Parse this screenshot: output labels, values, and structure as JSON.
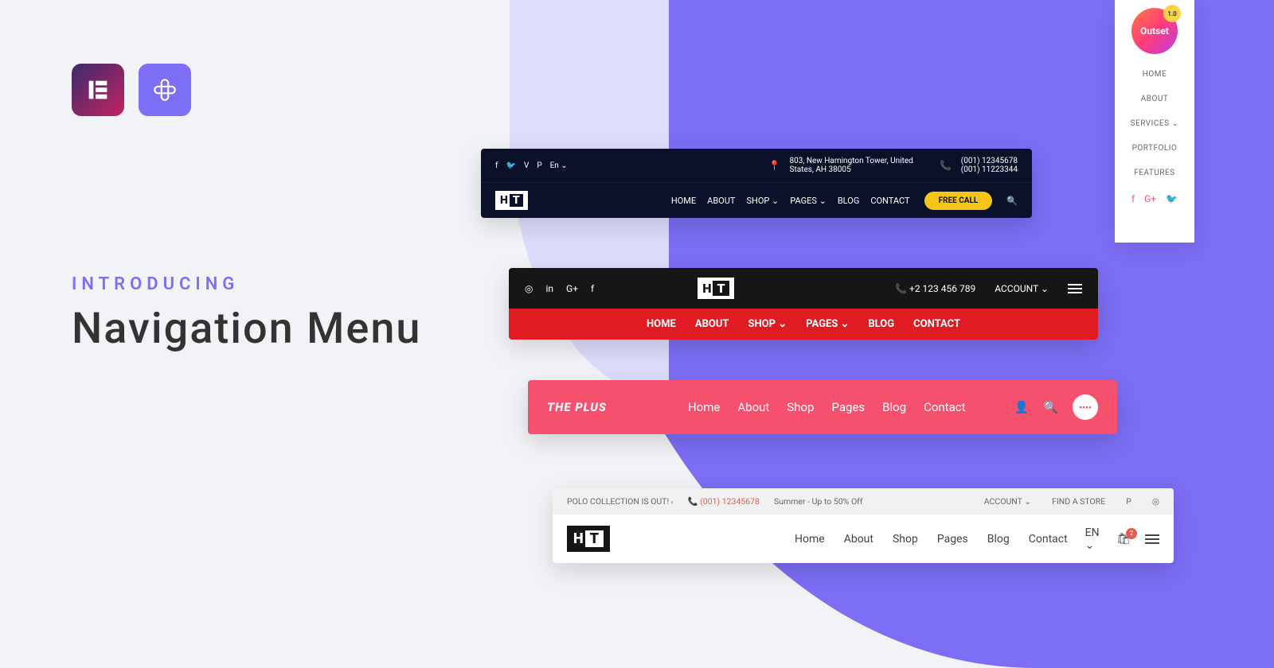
{
  "colors": {
    "purple": "#7c6ef5",
    "pink": "#f5506e",
    "red": "#e11b23",
    "yellow": "#f5c518",
    "dark": "#0b1128"
  },
  "headline": {
    "eyebrow": "INTRODUCING",
    "title": "Navigation Menu"
  },
  "outset": {
    "logo": "Outset",
    "badge": "1.0",
    "items": [
      "HOME",
      "ABOUT",
      "SERVICES ⌄",
      "PORTFOLIO",
      "FEATURES"
    ]
  },
  "nav1": {
    "lang": "En ⌄",
    "address_l1": "803, New Hamington Tower, United",
    "address_l2": "States, AH 38005",
    "phone1": "(001) 12345678",
    "phone2": "(001) 11223344",
    "menu": [
      "HOME",
      "ABOUT",
      "SHOP ⌄",
      "PAGES ⌄",
      "BLOG",
      "CONTACT"
    ],
    "cta": "FREE CALL"
  },
  "nav2": {
    "phone": "+2 123 456 789",
    "account": "ACCOUNT ⌄",
    "menu": [
      "HOME",
      "ABOUT",
      "SHOP ⌄",
      "PAGES ⌄",
      "BLOG",
      "CONTACT"
    ]
  },
  "nav3": {
    "brand": "THE PLUS",
    "menu": [
      "Home",
      "About",
      "Shop",
      "Pages",
      "Blog",
      "Contact"
    ],
    "circ": "••••"
  },
  "nav4": {
    "promo": "POLO COLLECTION IS OUT!",
    "phone": "(001) 12345678",
    "sale": "Summer - Up to 50% Off",
    "account": "ACCOUNT ⌄",
    "store": "FIND A STORE",
    "menu": [
      "Home",
      "About",
      "Shop",
      "Pages",
      "Blog",
      "Contact"
    ],
    "lang": "EN ⌄",
    "cart_count": "2"
  }
}
